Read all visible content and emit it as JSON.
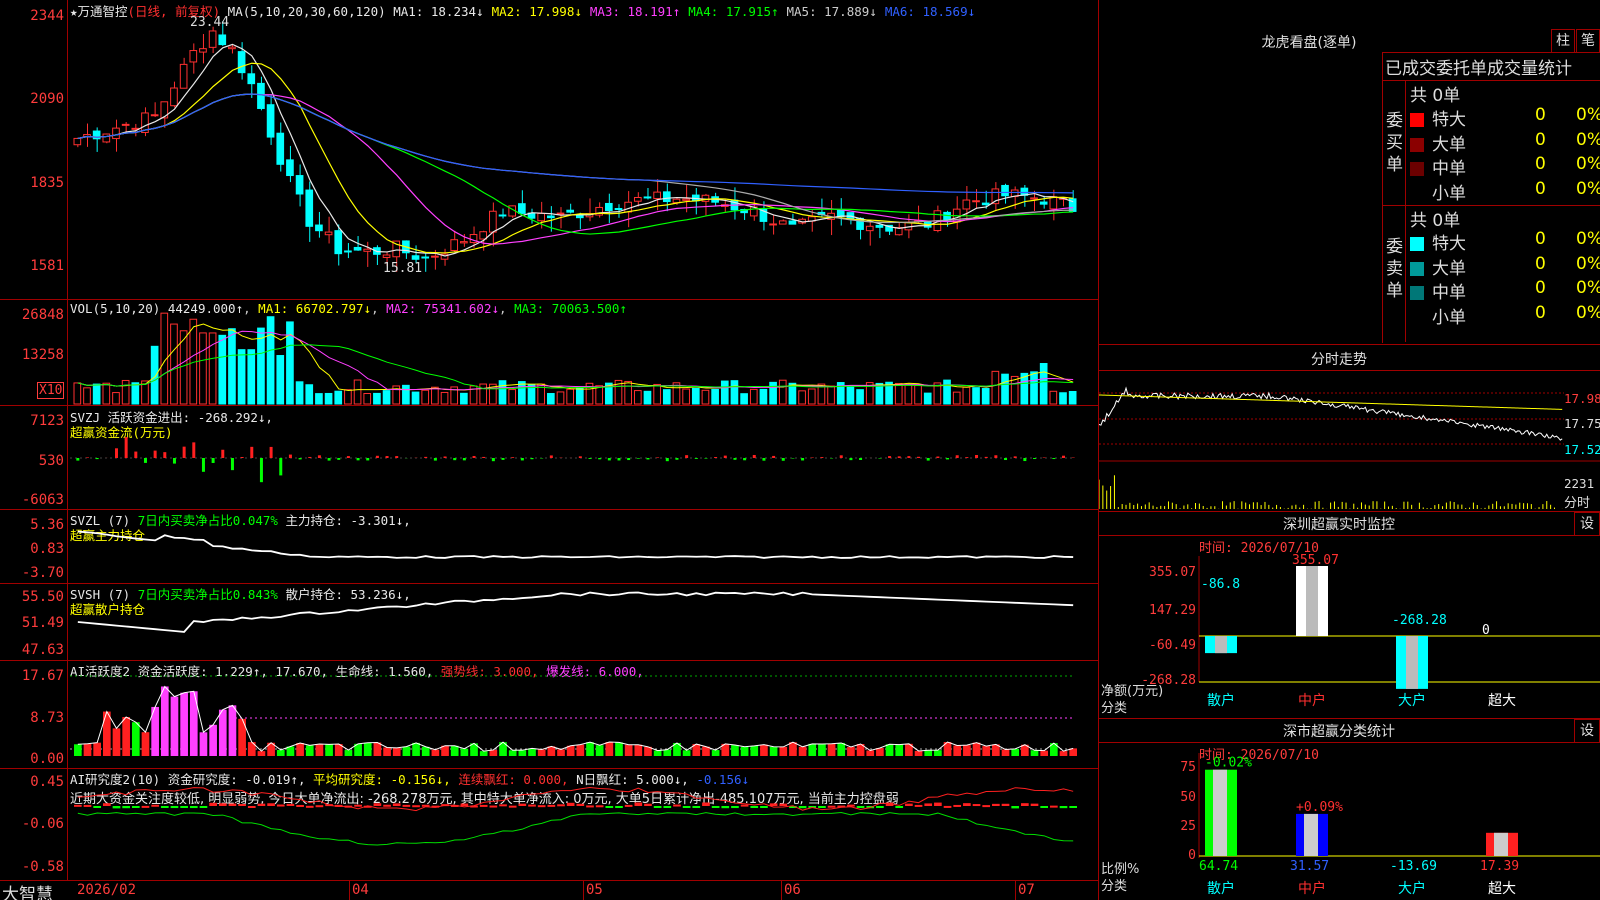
{
  "main": {
    "title": "★万通智控",
    "title_sub": "(日线, 前复权)",
    "ma_label": "MA(5,10,20,30,60,120)",
    "ma_values": [
      {
        "text": "MA1: 18.234↓",
        "color": "#e8e8e8"
      },
      {
        "text": "MA2: 17.998↓",
        "color": "#ffff00"
      },
      {
        "text": "MA3: 18.191↑",
        "color": "#ff40ff"
      },
      {
        "text": "MA4: 17.915↑",
        "color": "#00ff00"
      },
      {
        "text": "MA5: 17.889↓",
        "color": "#cccccc"
      },
      {
        "text": "MA6: 18.569↓",
        "color": "#3060ff"
      }
    ],
    "y_ticks": [
      "2344",
      "2090",
      "1835",
      "1581"
    ],
    "high_label": "23.44",
    "low_label": "15.81"
  },
  "vol": {
    "label": "VOL(5,10,20)",
    "value": "44249.000↑",
    "ma1": "MA1: 66702.797↓",
    "ma2": "MA2: 75341.602↓",
    "ma3": "MA3: 70063.500↑",
    "y_ticks": [
      "26848",
      "13258"
    ],
    "unit": "X10"
  },
  "svzj": {
    "label": "SVZJ",
    "text": "活跃资金进出: -268.292↓,",
    "sub": "超赢资金流(万元)",
    "y_ticks": [
      "7123",
      "530",
      "-6063"
    ]
  },
  "svzl": {
    "label": "SVZL (7)",
    "ratio": "7日内买卖净占比0.047%",
    "text": "主力持仓: -3.301↓,",
    "sub": "超赢主力持仓",
    "y_ticks": [
      "5.36",
      "0.83",
      "-3.70"
    ]
  },
  "svsh": {
    "label": "SVSH (7)",
    "ratio": "7日内买卖净占比0.843%",
    "text": "散户持仓: 53.236↓,",
    "sub": "超赢散户持仓",
    "y_ticks": [
      "55.50",
      "51.49",
      "47.63"
    ]
  },
  "ai1": {
    "label": "AI活跃度2",
    "t1": "资金活跃度: 1.229↑,",
    "t2": "17.670,",
    "t3": "生命线: 1.560,",
    "t4": "强势线: 3.000,",
    "t5": "爆发线: 6.000,",
    "y_ticks": [
      "17.67",
      "8.73",
      "0.00"
    ]
  },
  "ai2": {
    "label": "AI研究度2(10)",
    "t1": "资金研究度: -0.019↑,",
    "t2": "平均研究度: -0.156↓,",
    "t3": "连续飘红: 0.000,",
    "t4": "N日飘红: 5.000↓,",
    "t5": "-0.156↓",
    "summary": "近期大资金关注度较低, 明显弱势, 今日大单净流出: -268.278万元, 其中特大单净流入: 0万元, 大单5日累计净出-485.107万元, 当前主力控盘弱",
    "y_ticks": [
      "0.45",
      "-0.06",
      "-0.58"
    ]
  },
  "bottom": {
    "brand": "大智慧",
    "dates": [
      "2026/02",
      "04",
      "05",
      "06",
      "07"
    ]
  },
  "longhu": {
    "title": "龙虎看盘(逐单)",
    "btn1": "柱",
    "btn2": "笔",
    "header": "已成交委托单成交量统计",
    "buy_side": "委买单",
    "sell_side": "委卖单",
    "buy_total": "共 0单",
    "sell_total": "共 0单",
    "rows": [
      {
        "name": "特大",
        "num": "0",
        "pct": "0%"
      },
      {
        "name": "大单",
        "num": "0",
        "pct": "0%"
      },
      {
        "name": "中单",
        "num": "0",
        "pct": "0%"
      },
      {
        "name": "小单",
        "num": "0",
        "pct": "0%"
      }
    ],
    "buy_colors": [
      "#ff0000",
      "#8b0000",
      "#6b0000",
      "#000000"
    ],
    "sell_colors": [
      "#00ffff",
      "#009999",
      "#007777",
      "#000000"
    ]
  },
  "fenshi": {
    "title": "分时走势",
    "prices": [
      "17.98",
      "17.75",
      "17.52"
    ],
    "vol": "2231",
    "vol_label": "分时"
  },
  "monitor": {
    "title": "深圳超赢实时监控",
    "btn": "设",
    "date": "时间: 2026/07/10",
    "y_ticks": [
      "355.07",
      "147.29",
      "-60.49",
      "-268.28"
    ],
    "unit": "净额(万元)",
    "cat_label": "分类",
    "cats": [
      "散户",
      "中户",
      "大户",
      "超大"
    ],
    "values": [
      "-86.8",
      "355.07",
      "-268.28",
      "0"
    ]
  },
  "classify": {
    "title": "深市超赢分类统计",
    "btn": "设",
    "date": "时间: 2026/07/10",
    "y_ticks": [
      "75",
      "50",
      "25",
      "0"
    ],
    "ratio_label": "比例%",
    "cat_label": "分类",
    "cats": [
      "散户",
      "中户",
      "大户",
      "超大"
    ],
    "tops": [
      "-0.02%",
      "+0.09%",
      "",
      ""
    ],
    "bottoms": [
      "64.74",
      "31.57",
      "-13.69",
      "17.39"
    ]
  }
}
